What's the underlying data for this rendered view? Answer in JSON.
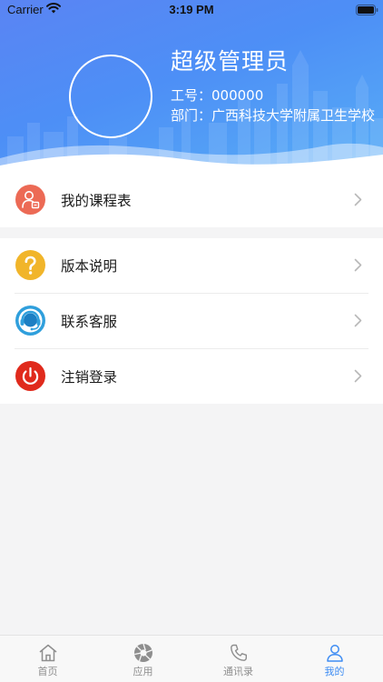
{
  "status_bar": {
    "carrier": "Carrier",
    "time": "3:19 PM"
  },
  "profile": {
    "name": "超级管理员",
    "employee_id": "工号：000000",
    "department": "部门：广西科技大学附属卫生学校"
  },
  "menu": {
    "schedule": {
      "label": "我的课程表",
      "icon": "schedule-user-icon",
      "color": "#ec6a55"
    },
    "version": {
      "label": "版本说明",
      "icon": "question-icon",
      "color": "#f1b52a"
    },
    "service": {
      "label": "联系客服",
      "icon": "headset-icon",
      "color": "#2f9fdc"
    },
    "logout": {
      "label": "注销登录",
      "icon": "power-icon",
      "color": "#e02a1c"
    }
  },
  "tabbar": {
    "tabs": [
      {
        "label": "首页",
        "icon": "home-icon",
        "active": false
      },
      {
        "label": "应用",
        "icon": "aperture-icon",
        "active": false
      },
      {
        "label": "通讯录",
        "icon": "phone-icon",
        "active": false
      },
      {
        "label": "我的",
        "icon": "person-icon",
        "active": true
      }
    ],
    "active_color": "#3d8cf3",
    "inactive_color": "#8e8e8e"
  },
  "colors": {
    "header_start": "#5a84f3",
    "header_end": "#58aef7",
    "background": "#f4f4f5"
  }
}
